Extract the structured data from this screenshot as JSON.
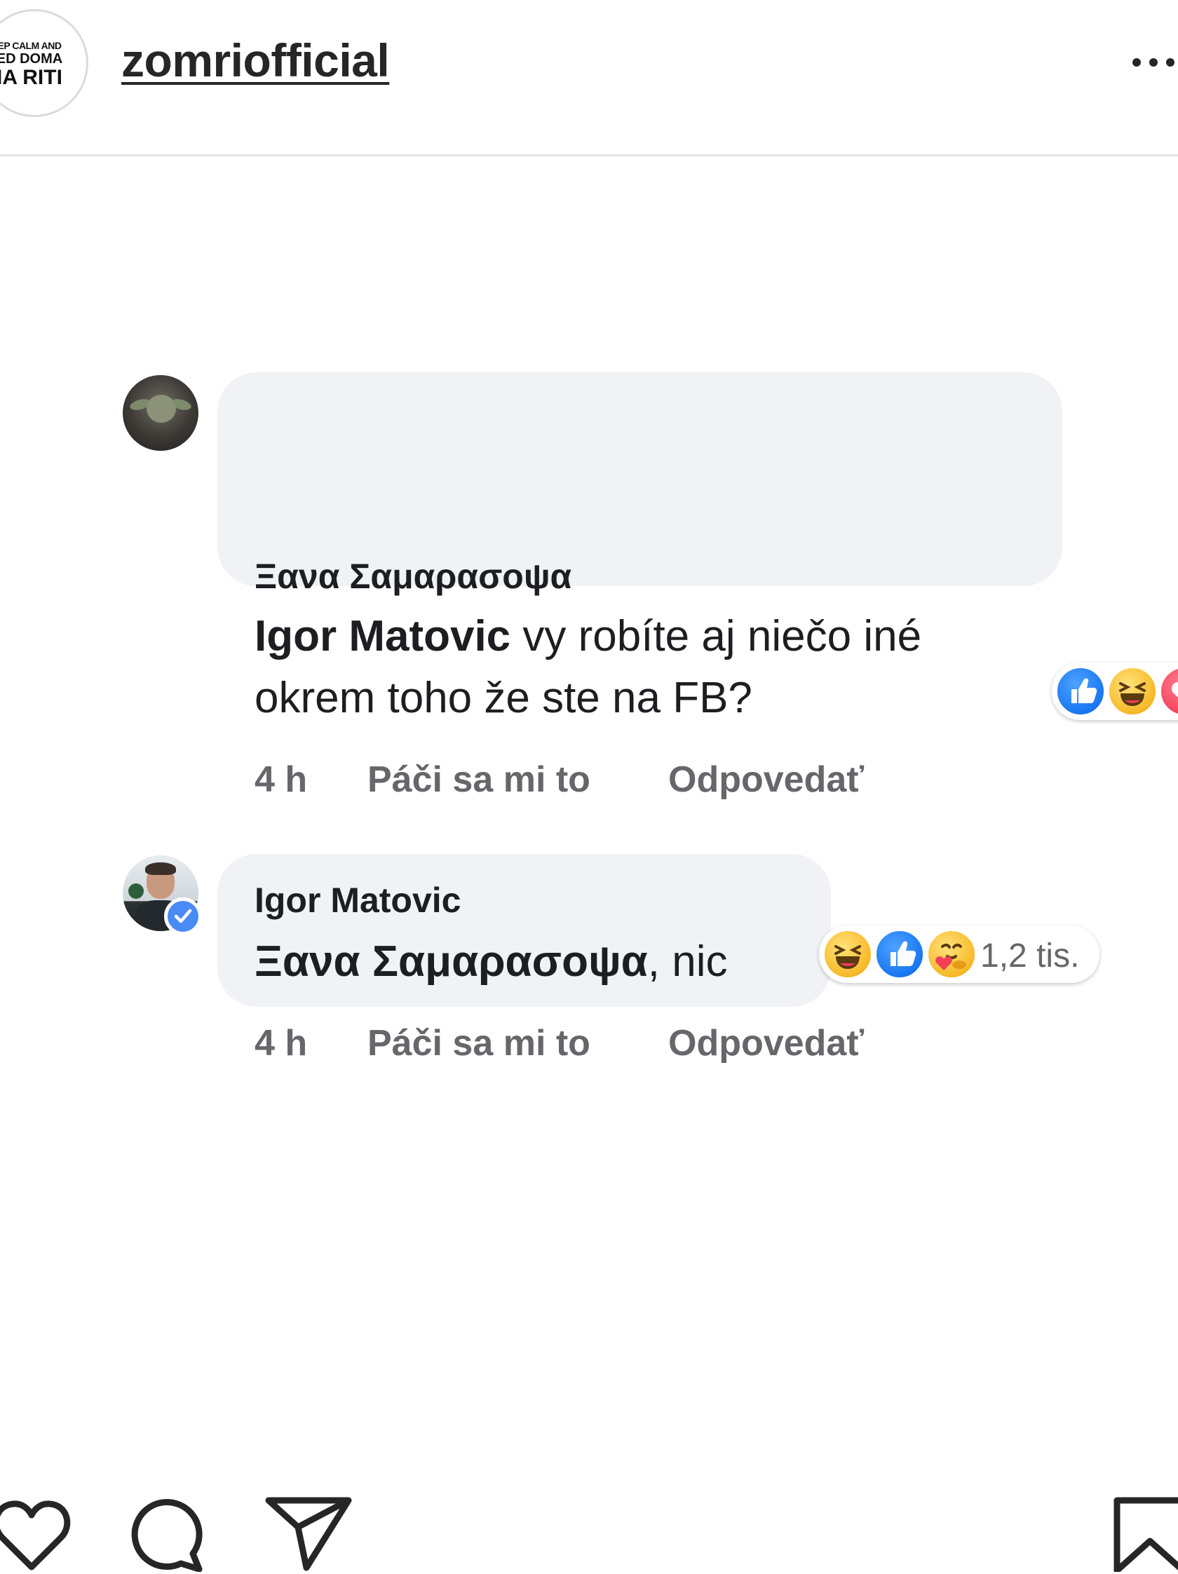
{
  "header": {
    "avatar_text": [
      "EP CALM AND",
      "ED DOMA",
      "IA RITI"
    ],
    "username": "zomriofficial",
    "more_icon": "more-horizontal-icon"
  },
  "comments": [
    {
      "author": "Ξανα Σαμαρασοψα",
      "mention": "Igor Matovic",
      "text_rest": " vy robíte aj niečo iné",
      "text_line2": "okrem toho že ste na FB?",
      "reactions": [
        "like-reaction-icon",
        "haha-reaction-icon",
        "love-reaction-icon"
      ],
      "time": "4 h",
      "like_label": "Páči sa mi to",
      "reply_label": "Odpovedať"
    },
    {
      "author": "Igor Matovic",
      "verified": true,
      "mention": "Ξανα Σαμαρασοψα",
      "text_rest": ", nic",
      "reactions": [
        "haha-reaction-icon",
        "like-reaction-icon",
        "care-reaction-icon"
      ],
      "reaction_count": "1,2 tis.",
      "time": "4 h",
      "like_label": "Páči sa mi to",
      "reply_label": "Odpovedať"
    }
  ],
  "actions": {
    "icons": [
      "heart-icon",
      "comment-icon",
      "send-icon",
      "bookmark-icon"
    ]
  },
  "colors": {
    "bubble": "#f0f2f5",
    "meta_text": "#65676b",
    "like_blue": "#1877f2",
    "verified_blue": "#4a8af4"
  }
}
